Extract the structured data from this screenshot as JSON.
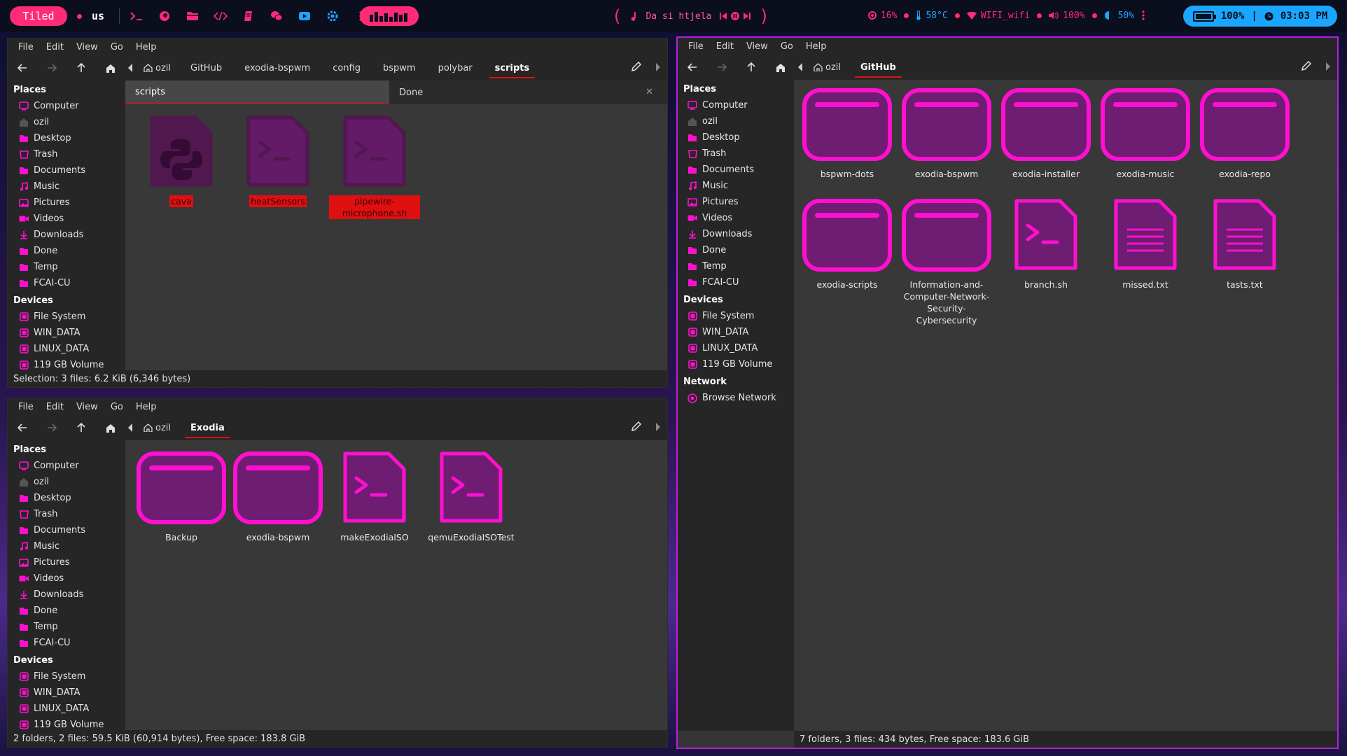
{
  "topbar": {
    "layout_label": "Tiled",
    "keyboard_layout": "us",
    "music_title": "Da si htjela",
    "cpu": "16%",
    "temp": "58°C",
    "wifi": "WIFI_wifi",
    "volume": "100%",
    "brightness": "50%",
    "battery": "100%",
    "time": "03:03 PM",
    "colors": {
      "accent": "#ff2b77",
      "clock": "#1aa6ff",
      "active_border": "#b621d6",
      "icon": "#ff10d0",
      "selection": "#e01010"
    },
    "launcher_icons": [
      "terminal-icon",
      "firefox-icon",
      "files-icon",
      "code-icon",
      "notes-icon",
      "chat-icon",
      "media-icon",
      "settings-icon",
      "more-icon"
    ]
  },
  "menus": [
    "File",
    "Edit",
    "View",
    "Go",
    "Help"
  ],
  "sidebar": {
    "places_title": "Places",
    "places": [
      {
        "label": "Computer",
        "icon": "computer-icon"
      },
      {
        "label": "ozil",
        "icon": "home-icon"
      },
      {
        "label": "Desktop",
        "icon": "desktop-icon"
      },
      {
        "label": "Trash",
        "icon": "trash-icon"
      },
      {
        "label": "Documents",
        "icon": "folder-icon"
      },
      {
        "label": "Music",
        "icon": "music-icon"
      },
      {
        "label": "Pictures",
        "icon": "pictures-icon"
      },
      {
        "label": "Videos",
        "icon": "videos-icon"
      },
      {
        "label": "Downloads",
        "icon": "downloads-icon"
      },
      {
        "label": "Done",
        "icon": "folder-icon"
      },
      {
        "label": "Temp",
        "icon": "folder-icon"
      },
      {
        "label": "FCAI-CU",
        "icon": "folder-icon"
      }
    ],
    "devices_title": "Devices",
    "devices": [
      {
        "label": "File System"
      },
      {
        "label": "WIN_DATA"
      },
      {
        "label": "LINUX_DATA"
      },
      {
        "label": "119 GB Volume"
      }
    ],
    "network_title": "Network",
    "network": [
      {
        "label": "Browse Network"
      }
    ]
  },
  "win1": {
    "crumbs": [
      "ozil",
      "GitHub",
      "exodia-bspwm",
      "config",
      "bspwm",
      "polybar",
      "scripts"
    ],
    "tabs": [
      "scripts",
      "Done"
    ],
    "files": [
      {
        "name": "cava",
        "type": "python"
      },
      {
        "name": "heatSensors",
        "type": "script"
      },
      {
        "name": "pipewire-microphone.sh",
        "type": "script"
      }
    ],
    "status": "Selection: 3 files: 6.2 KiB (6,346 bytes)"
  },
  "win2": {
    "crumbs": [
      "ozil",
      "Exodia"
    ],
    "files": [
      {
        "name": "Backup",
        "type": "folder"
      },
      {
        "name": "exodia-bspwm",
        "type": "folder"
      },
      {
        "name": "makeExodiaISO",
        "type": "script"
      },
      {
        "name": "qemuExodiaISOTest",
        "type": "script"
      }
    ],
    "status": "2 folders, 2 files: 59.5 KiB (60,914 bytes), Free space: 183.8 GiB"
  },
  "win3": {
    "crumbs": [
      "ozil",
      "GitHub"
    ],
    "files": [
      {
        "name": "bspwm-dots",
        "type": "folder"
      },
      {
        "name": "exodia-bspwm",
        "type": "folder"
      },
      {
        "name": "exodia-installer",
        "type": "folder"
      },
      {
        "name": "exodia-music",
        "type": "folder"
      },
      {
        "name": "exodia-repo",
        "type": "folder"
      },
      {
        "name": "exodia-scripts",
        "type": "folder"
      },
      {
        "name": "Information-and-Computer-Network-Security-Cybersecurity",
        "type": "folder"
      },
      {
        "name": "branch.sh",
        "type": "script"
      },
      {
        "name": "missed.txt",
        "type": "text"
      },
      {
        "name": "tasts.txt",
        "type": "text"
      }
    ],
    "status": "7 folders, 3 files: 434 bytes, Free space: 183.6 GiB"
  }
}
